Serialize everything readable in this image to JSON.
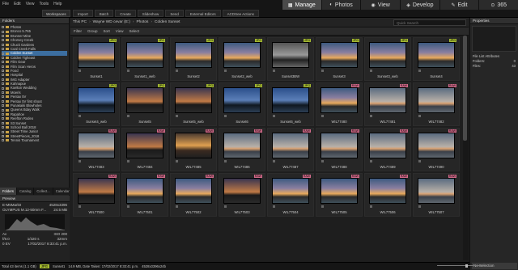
{
  "menu": [
    "File",
    "Edit",
    "View",
    "Tools",
    "Help"
  ],
  "workspaces": "Workspaces",
  "toolbar": [
    "Import",
    "Batch",
    "Create",
    "Slideshow",
    "Send",
    "External Editors",
    "ACDSee Actions"
  ],
  "modes": [
    {
      "label": "Manage",
      "icon": "▦"
    },
    {
      "label": "Photos",
      "icon": "◐"
    },
    {
      "label": "View",
      "icon": "◉"
    },
    {
      "label": "Develop",
      "icon": "◈"
    },
    {
      "label": "Edit",
      "icon": "✎"
    },
    {
      "label": "365",
      "icon": "⊙"
    }
  ],
  "panels": {
    "folders": "Folders",
    "preview": "Preview",
    "properties": "Properties"
  },
  "tree": [
    {
      "label": "Photos",
      "sel": false
    },
    {
      "label": "Bronco 5.765",
      "sel": false
    },
    {
      "label": "Brunner Mine",
      "sel": false
    },
    {
      "label": "Chorney Creek",
      "sel": false
    },
    {
      "label": "Chuck Gardens",
      "sel": false
    },
    {
      "label": "Coal Creek Falls",
      "sel": false
    },
    {
      "label": "Colden Sunset",
      "sel": true
    },
    {
      "label": "Colden Tigheast",
      "sel": false
    },
    {
      "label": "Film Gear",
      "sel": false
    },
    {
      "label": "Film Scan Heros",
      "sel": false
    },
    {
      "label": "Food",
      "sel": false
    },
    {
      "label": "Hospital",
      "sel": false
    },
    {
      "label": "IMG Adapter",
      "sel": false
    },
    {
      "label": "Kahnapue",
      "sel": false
    },
    {
      "label": "Koelton Wedding",
      "sel": false
    },
    {
      "label": "Moeris",
      "sel": false
    },
    {
      "label": "Pentax 5V",
      "sel": false
    },
    {
      "label": "Pentax 5V first shoot",
      "sel": false
    },
    {
      "label": "Punakaiki Blowholes",
      "sel": false
    },
    {
      "label": "Queens Bday Walk",
      "sel": false
    },
    {
      "label": "Rapahoe",
      "sel": false
    },
    {
      "label": "Reefton Rodeo",
      "sel": false
    },
    {
      "label": "S3 Sunset",
      "sel": false
    },
    {
      "label": "School Ball 2018",
      "sel": false
    },
    {
      "label": "Street Time Junior",
      "sel": false
    },
    {
      "label": "StreetPieces_2018",
      "sel": false
    },
    {
      "label": "Tennis Tournament",
      "sel": false
    }
  ],
  "folder_tabs": [
    "Folders",
    "Catalog",
    "Collect...",
    "Calendar"
  ],
  "breadcrumb": [
    "This PC",
    "Wayne WD cevar (E:)",
    "Photos",
    "Colden Sunset"
  ],
  "search_placeholder": "Quick Search",
  "filter_bar": [
    "Filter",
    "Group",
    "Sort",
    "View",
    "Select"
  ],
  "thumbnails": [
    {
      "name": "Sunset1",
      "type": "JPG",
      "tone": "dusk"
    },
    {
      "name": "Sunset1_web",
      "type": "JPG",
      "tone": "dusk"
    },
    {
      "name": "Sunset2",
      "type": "JPG",
      "tone": "dusk"
    },
    {
      "name": "Sunset2_web",
      "type": "JPG",
      "tone": "dusk"
    },
    {
      "name": "Sunset3BW",
      "type": "JPG",
      "tone": "bw"
    },
    {
      "name": "Sunset3",
      "type": "JPG",
      "tone": "dusk"
    },
    {
      "name": "Sunset3_web",
      "type": "JPG",
      "tone": "dusk"
    },
    {
      "name": "Sunset4",
      "type": "JPG",
      "tone": "dusk"
    },
    {
      "name": "Sunset4_web",
      "type": "JPG",
      "tone": "blue"
    },
    {
      "name": "Sunset5",
      "type": "JPG",
      "tone": "dark"
    },
    {
      "name": "Sunset5_web",
      "type": "JPG",
      "tone": "dark"
    },
    {
      "name": "Sunset6",
      "type": "JPG",
      "tone": "blue"
    },
    {
      "name": "Sunset6_web",
      "type": "JPG",
      "tone": "blue"
    },
    {
      "name": "WIL77480",
      "type": "RAW",
      "tone": "dusk"
    },
    {
      "name": "WIL77481",
      "type": "RAW",
      "tone": "pale"
    },
    {
      "name": "WIL77482",
      "type": "RAW",
      "tone": "pale"
    },
    {
      "name": "WIL77483",
      "type": "RAW",
      "tone": "pale"
    },
    {
      "name": "WIL77484",
      "type": "RAW",
      "tone": "dark"
    },
    {
      "name": "WIL77485",
      "type": "RAW",
      "tone": "gold"
    },
    {
      "name": "WIL77486",
      "type": "RAW",
      "tone": "pale"
    },
    {
      "name": "WIL77487",
      "type": "RAW",
      "tone": "pale"
    },
    {
      "name": "WIL77488",
      "type": "RAW",
      "tone": "pale"
    },
    {
      "name": "WIL77489",
      "type": "RAW",
      "tone": "pale"
    },
    {
      "name": "WIL77490",
      "type": "RAW",
      "tone": "pale"
    },
    {
      "name": "WIL77500",
      "type": "RAW",
      "tone": "dark"
    },
    {
      "name": "WIL77501",
      "type": "RAW",
      "tone": "dusk"
    },
    {
      "name": "WIL77502",
      "type": "RAW",
      "tone": "dusk"
    },
    {
      "name": "WIL77503",
      "type": "RAW",
      "tone": "dark"
    },
    {
      "name": "WIL77504",
      "type": "RAW",
      "tone": "dusk"
    },
    {
      "name": "WIL77505",
      "type": "RAW",
      "tone": "dusk"
    },
    {
      "name": "WIL77506",
      "type": "RAW",
      "tone": "dusk"
    },
    {
      "name": "WIL77507",
      "type": "RAW",
      "tone": "pale"
    }
  ],
  "preview_info": {
    "camera": "E-M5MarkII",
    "res": "4528x3396",
    "lens": "OLYMPUS M.12-50mm F...",
    "size": "24.5 MB",
    "av": "Av",
    "fstop": "f/9.0",
    "shutter": "1/320 s",
    "iso": "ISO 200",
    "ev": "0 EV",
    "focal": "32mm",
    "date": "17/02/2017 8:33:41 p.m."
  },
  "preview_tabs": [
    "Preview",
    "ImgInfo"
  ],
  "props": {
    "title": "File List Attributes",
    "folders_label": "Folders:",
    "folders": "0",
    "files_label": "Files:",
    "files": "43",
    "no_selection": "No Selection"
  },
  "status": {
    "total": "Total 43 items (1.1 GB)",
    "tag": "JPG",
    "file": "Sunset1",
    "size": "14.9 MB, Date Taken: 17/02/2017 8:33:41 p.m.",
    "dims": "4528x3396x24b"
  }
}
